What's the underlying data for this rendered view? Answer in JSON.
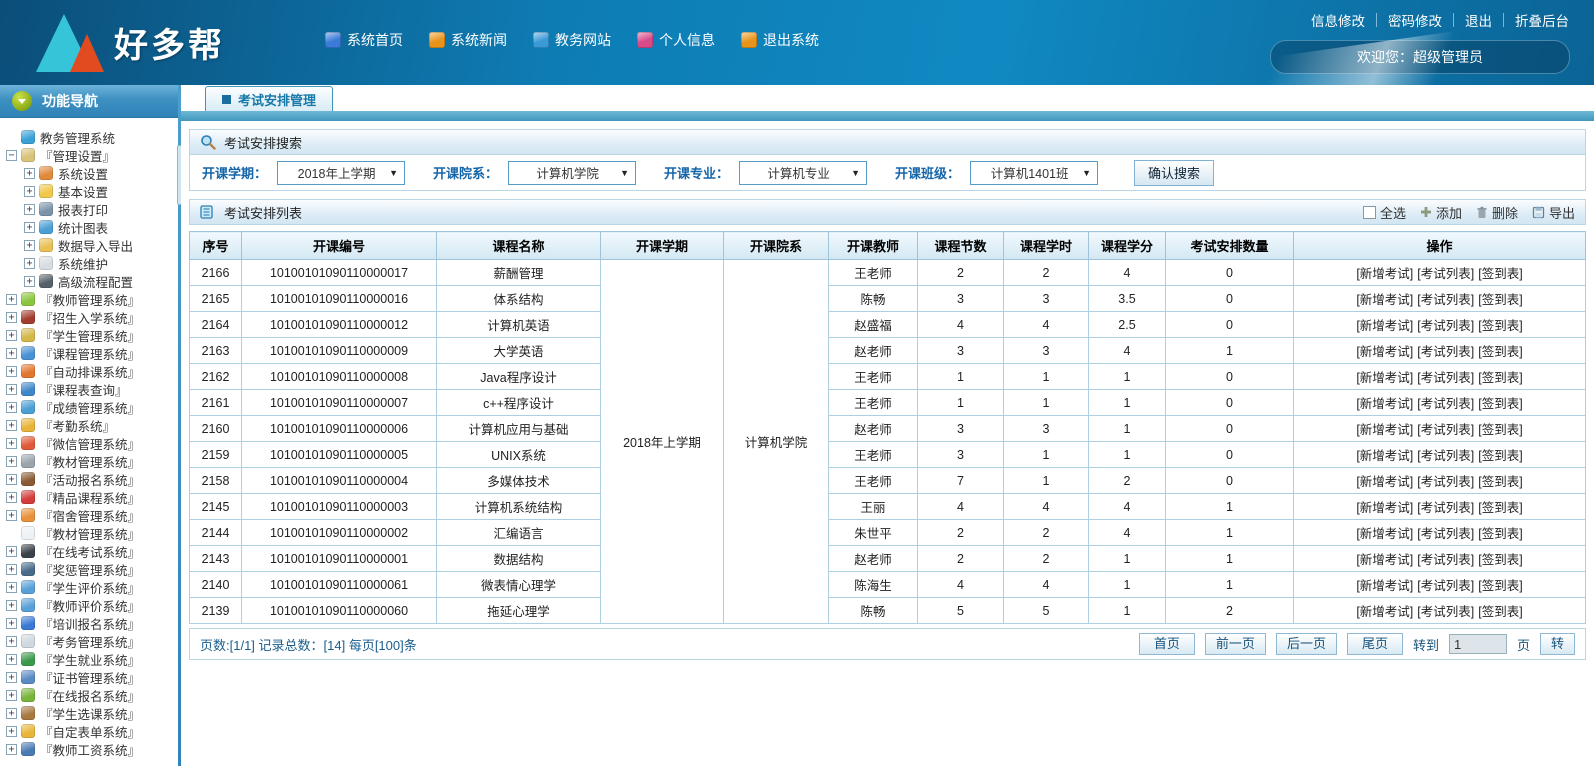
{
  "colors": {
    "topbar_blue": "#0e7cb4",
    "accent_blue": "#1565a8",
    "band_blue": "#4197bd",
    "red_count": "#e04a1f",
    "logo_cyan": "#35c4d8",
    "logo_red": "#e24a1f"
  },
  "header": {
    "logo_text": "好多帮",
    "nav": [
      {
        "label": "系统首页",
        "icon": "home-icon",
        "color": "#3a7ad8"
      },
      {
        "label": "系统新闻",
        "icon": "news-icon",
        "color": "#e8941a"
      },
      {
        "label": "教务网站",
        "icon": "site-icon",
        "color": "#3a9ad8"
      },
      {
        "label": "个人信息",
        "icon": "profile-icon",
        "color": "#d84a8a"
      },
      {
        "label": "退出系统",
        "icon": "exit-icon",
        "color": "#e8941a"
      }
    ],
    "top_links": [
      "信息修改",
      "密码修改",
      "退出",
      "折叠后台"
    ],
    "welcome": "欢迎您：超级管理员"
  },
  "sidebar": {
    "title": "功能导航",
    "items": [
      {
        "label": "教务管理系统",
        "icon": "globe-icon",
        "color": "#3aa0d8",
        "expander": "none",
        "level": 1
      },
      {
        "label": "『管理设置』",
        "icon": "folder-icon",
        "color": "#d8c37a",
        "expander": "minus",
        "level": 1
      },
      {
        "label": "系统设置",
        "icon": "system-icon",
        "color": "#e08a3c",
        "expander": "plus",
        "level": 2
      },
      {
        "label": "基本设置",
        "icon": "basic-icon",
        "color": "#f0c84a",
        "expander": "plus",
        "level": 2
      },
      {
        "label": "报表打印",
        "icon": "print-icon",
        "color": "#7a93a8",
        "expander": "plus",
        "level": 2
      },
      {
        "label": "统计图表",
        "icon": "chart-icon",
        "color": "#4a9fd4",
        "expander": "plus",
        "level": 2
      },
      {
        "label": "数据导入导出",
        "icon": "import-icon",
        "color": "#e8c055",
        "expander": "plus",
        "level": 2
      },
      {
        "label": "系统维护",
        "icon": "maintain-icon",
        "color": "#d8dde2",
        "expander": "plus",
        "level": 2
      },
      {
        "label": "高级流程配置",
        "icon": "workflow-icon",
        "color": "#55606a",
        "expander": "plus",
        "level": 2
      },
      {
        "label": "『教师管理系统』",
        "icon": "teacher-icon",
        "color": "#8cc63f",
        "expander": "plus",
        "level": 1
      },
      {
        "label": "『招生入学系统』",
        "icon": "admission-icon",
        "color": "#a33c2e",
        "expander": "plus",
        "level": 1
      },
      {
        "label": "『学生管理系统』",
        "icon": "student-icon",
        "color": "#d4b84a",
        "expander": "plus",
        "level": 1
      },
      {
        "label": "『课程管理系统』",
        "icon": "course-icon",
        "color": "#4a90d4",
        "expander": "plus",
        "level": 1
      },
      {
        "label": "『自动排课系统』",
        "icon": "schedule-icon",
        "color": "#e2762f",
        "expander": "plus",
        "level": 1
      },
      {
        "label": "『课程表查询』",
        "icon": "lookup-icon",
        "color": "#3f87c9",
        "expander": "plus",
        "level": 1
      },
      {
        "label": "『成绩管理系统』",
        "icon": "score-icon",
        "color": "#4a9fd4",
        "expander": "plus",
        "level": 1
      },
      {
        "label": "『考勤系统』",
        "icon": "attend-icon",
        "color": "#e8b53a",
        "expander": "plus",
        "level": 1
      },
      {
        "label": "『微信管理系统』",
        "icon": "wechat-icon",
        "color": "#e05a3a",
        "expander": "plus",
        "level": 1
      },
      {
        "label": "『教材管理系统』",
        "icon": "material-icon",
        "color": "#9aa4ad",
        "expander": "plus",
        "level": 1
      },
      {
        "label": "『活动报名系统』",
        "icon": "activity-icon",
        "color": "#8a5a32",
        "expander": "plus",
        "level": 1
      },
      {
        "label": "『精品课程系统』",
        "icon": "premium-icon",
        "color": "#d43c3c",
        "expander": "plus",
        "level": 1
      },
      {
        "label": "『宿舍管理系统』",
        "icon": "dorm-icon",
        "color": "#e8913a",
        "expander": "plus",
        "level": 1
      },
      {
        "label": "『教材管理系统』",
        "icon": "doc-icon",
        "color": "#eef2f5",
        "expander": "none",
        "level": 1
      },
      {
        "label": "『在线考试系统』",
        "icon": "exam-icon",
        "color": "#3a4148",
        "expander": "plus",
        "level": 1
      },
      {
        "label": "『奖惩管理系统』",
        "icon": "reward-icon",
        "color": "#4a6a8a",
        "expander": "plus",
        "level": 1
      },
      {
        "label": "『学生评价系统』",
        "icon": "stueval-icon",
        "color": "#5aa0d8",
        "expander": "plus",
        "level": 1
      },
      {
        "label": "『教师评价系统』",
        "icon": "teaeval-icon",
        "color": "#5aa0d8",
        "expander": "plus",
        "level": 1
      },
      {
        "label": "『培训报名系统』",
        "icon": "training-icon",
        "color": "#3a7ad4",
        "expander": "plus",
        "level": 1
      },
      {
        "label": "『考务管理系统』",
        "icon": "examaffair-icon",
        "color": "#cfd8de",
        "expander": "plus",
        "level": 1
      },
      {
        "label": "『学生就业系统』",
        "icon": "job-icon",
        "color": "#3a9a4a",
        "expander": "plus",
        "level": 1
      },
      {
        "label": "『证书管理系统』",
        "icon": "cert-icon",
        "color": "#5a8ac4",
        "expander": "plus",
        "level": 1
      },
      {
        "label": "『在线报名系统』",
        "icon": "signup-icon",
        "color": "#7ab43a",
        "expander": "plus",
        "level": 1
      },
      {
        "label": "『学生选课系统』",
        "icon": "elective-icon",
        "color": "#a87840",
        "expander": "plus",
        "level": 1
      },
      {
        "label": "『自定表单系统』",
        "icon": "form-icon",
        "color": "#e8b53a",
        "expander": "plus",
        "level": 1
      },
      {
        "label": "『教师工资系统』",
        "icon": "salary-icon",
        "color": "#4a7ab4",
        "expander": "plus",
        "level": 1
      }
    ]
  },
  "tab": {
    "label": "考试安排管理"
  },
  "search_panel": {
    "title": "考试安排搜索",
    "filters": [
      {
        "label": "开课学期：",
        "value": "2018年上学期"
      },
      {
        "label": "开课院系：",
        "value": "计算机学院"
      },
      {
        "label": "开课专业：",
        "value": "计算机专业"
      },
      {
        "label": "开课班级：",
        "value": "计算机1401班"
      }
    ],
    "search_button": "确认搜索"
  },
  "list_panel": {
    "title": "考试安排列表",
    "tools": {
      "select_all": "全选",
      "add": "添加",
      "delete": "删除",
      "export": "导出"
    }
  },
  "table": {
    "headers": [
      "序号",
      "开课编号",
      "课程名称",
      "开课学期",
      "开课院系",
      "开课教师",
      "课程节数",
      "课程学时",
      "课程学分",
      "考试安排数量",
      "操作"
    ],
    "merged": {
      "semester": "2018年上学期",
      "department": "计算机学院"
    },
    "action_links": [
      "[新增考试]",
      "[考试列表]",
      "[签到表]"
    ],
    "rows": [
      {
        "id": "2166",
        "code": "10100101090110000017",
        "course": "薪酬管理",
        "teacher": "王老师",
        "sections": "2",
        "hours": "2",
        "credits": "4",
        "exams": "0"
      },
      {
        "id": "2165",
        "code": "10100101090110000016",
        "course": "体系结构",
        "teacher": "陈畅",
        "sections": "3",
        "hours": "3",
        "credits": "3.5",
        "exams": "0"
      },
      {
        "id": "2164",
        "code": "10100101090110000012",
        "course": "计算机英语",
        "teacher": "赵盛福",
        "sections": "4",
        "hours": "4",
        "credits": "2.5",
        "exams": "0"
      },
      {
        "id": "2163",
        "code": "10100101090110000009",
        "course": "大学英语",
        "teacher": "赵老师",
        "sections": "3",
        "hours": "3",
        "credits": "4",
        "exams": "1"
      },
      {
        "id": "2162",
        "code": "10100101090110000008",
        "course": "Java程序设计",
        "teacher": "王老师",
        "sections": "1",
        "hours": "1",
        "credits": "1",
        "exams": "0"
      },
      {
        "id": "2161",
        "code": "10100101090110000007",
        "course": "c++程序设计",
        "teacher": "王老师",
        "sections": "1",
        "hours": "1",
        "credits": "1",
        "exams": "0"
      },
      {
        "id": "2160",
        "code": "10100101090110000006",
        "course": "计算机应用与基础",
        "teacher": "赵老师",
        "sections": "3",
        "hours": "3",
        "credits": "1",
        "exams": "0"
      },
      {
        "id": "2159",
        "code": "10100101090110000005",
        "course": "UNIX系统",
        "teacher": "王老师",
        "sections": "3",
        "hours": "1",
        "credits": "1",
        "exams": "0"
      },
      {
        "id": "2158",
        "code": "10100101090110000004",
        "course": "多媒体技术",
        "teacher": "王老师",
        "sections": "7",
        "hours": "1",
        "credits": "2",
        "exams": "0"
      },
      {
        "id": "2145",
        "code": "10100101090110000003",
        "course": "计算机系统结构",
        "teacher": "王丽",
        "sections": "4",
        "hours": "4",
        "credits": "4",
        "exams": "1"
      },
      {
        "id": "2144",
        "code": "10100101090110000002",
        "course": "汇编语言",
        "teacher": "朱世平",
        "sections": "2",
        "hours": "2",
        "credits": "4",
        "exams": "1"
      },
      {
        "id": "2143",
        "code": "10100101090110000001",
        "course": "数据结构",
        "teacher": "赵老师",
        "sections": "2",
        "hours": "2",
        "credits": "1",
        "exams": "1"
      },
      {
        "id": "2140",
        "code": "10100101090110000061",
        "course": "微表情心理学",
        "teacher": "陈海生",
        "sections": "4",
        "hours": "4",
        "credits": "1",
        "exams": "1"
      },
      {
        "id": "2139",
        "code": "10100101090110000060",
        "course": "拖延心理学",
        "teacher": "陈畅",
        "sections": "5",
        "hours": "5",
        "credits": "1",
        "exams": "2"
      }
    ]
  },
  "pagination": {
    "info": "页数:[1/1] 记录总数：[14] 每页[100]条",
    "buttons": [
      "首页",
      "前一页",
      "后一页",
      "尾页"
    ],
    "goto_label": "转到",
    "goto_value": "1",
    "page_label": "页",
    "go_button": "转"
  }
}
